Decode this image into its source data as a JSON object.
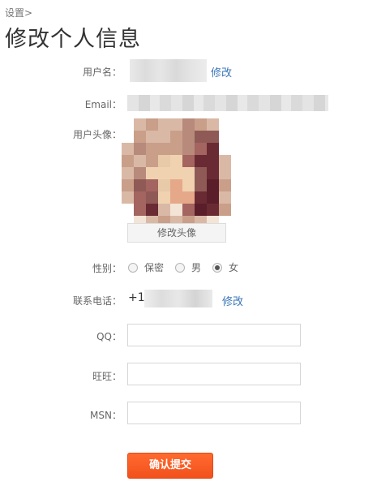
{
  "breadcrumb": "设置>",
  "page_title": "修改个人信息",
  "username": {
    "label": "用户名：",
    "edit_link": "修改"
  },
  "email": {
    "label": "Email："
  },
  "avatar": {
    "label": "用户头像：",
    "change_button": "修改头像"
  },
  "gender": {
    "label": "性别：",
    "options": [
      "保密",
      "男",
      "女"
    ],
    "selected": "女"
  },
  "phone": {
    "label": "联系电话：",
    "prefix": "+1",
    "edit_link": "修改"
  },
  "qq": {
    "label": "QQ：",
    "value": ""
  },
  "wangwang": {
    "label": "旺旺：",
    "value": ""
  },
  "msn": {
    "label": "MSN：",
    "value": ""
  },
  "submit_label": "确认提交",
  "colors": {
    "link": "#3a76b8",
    "submit": "#f2511c"
  }
}
